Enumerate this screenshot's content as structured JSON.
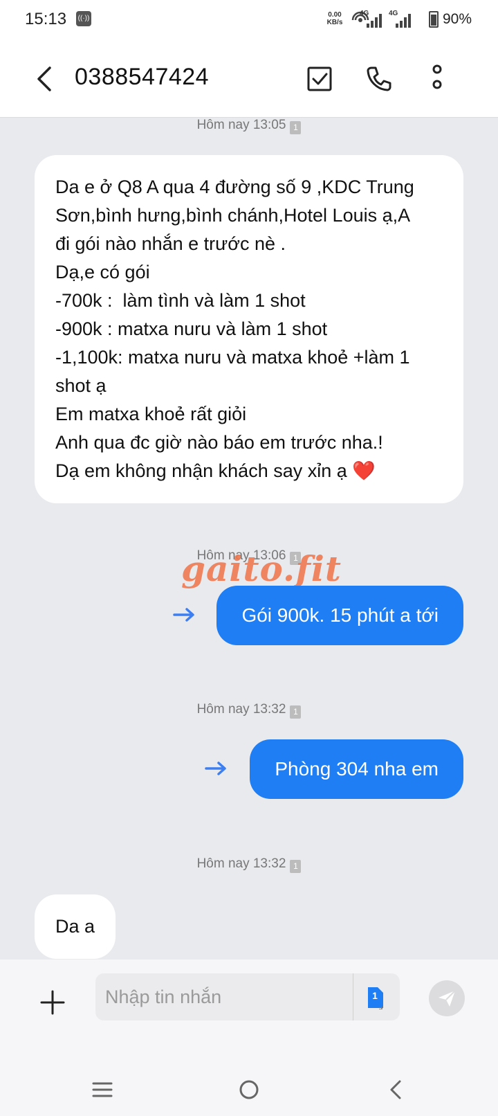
{
  "status_bar": {
    "time": "15:13",
    "net_speed_value": "0.00",
    "net_speed_unit": "KB/s",
    "network_1": "4G",
    "network_2": "4G",
    "battery": "90%"
  },
  "header": {
    "title": "0388547424",
    "icons": [
      "back-icon",
      "select-checkbox-icon",
      "phone-icon",
      "more-vert-icon"
    ]
  },
  "messages": [
    {
      "timestamp": "Hôm nay 13:05",
      "sim": "1",
      "direction": "incoming",
      "text": "Da e ở Q8 A qua 4 đường số 9 ,KDC Trung\nSơn,bình hưng,bình chánh,Hotel Louis ạ,A\nđi gói nào nhắn e trước nè .\nDạ,e có gói\n-700k :  làm tình và làm 1 shot\n-900k : matxa nuru và làm 1 shot\n-1,100k: matxa nuru và matxa khoẻ +làm 1\nshot ạ\nEm matxa khoẻ rất giỏi\nAnh qua đc giờ nào báo em trước nha.!\nDạ em không nhận khách say xỉn ạ ❤️"
    },
    {
      "timestamp": "Hôm nay 13:06",
      "sim": "1",
      "direction": "outgoing",
      "text": "Gói 900k. 15 phút a tới"
    },
    {
      "timestamp": "Hôm nay 13:32",
      "sim": "1",
      "direction": "outgoing",
      "text": "Phòng 304 nha em"
    },
    {
      "timestamp": "Hôm nay 13:32",
      "sim": "1",
      "direction": "incoming",
      "text": "Da a"
    }
  ],
  "watermark": "gaito.fit",
  "composer": {
    "placeholder": "Nhập tin nhắn",
    "sim_label": "1"
  },
  "colors": {
    "outgoing_bubble": "#1f7ef3",
    "incoming_bubble": "#ffffff",
    "background": "#e9eaee",
    "watermark": "#f0764e",
    "forward_arrow": "#3d7ef0"
  }
}
